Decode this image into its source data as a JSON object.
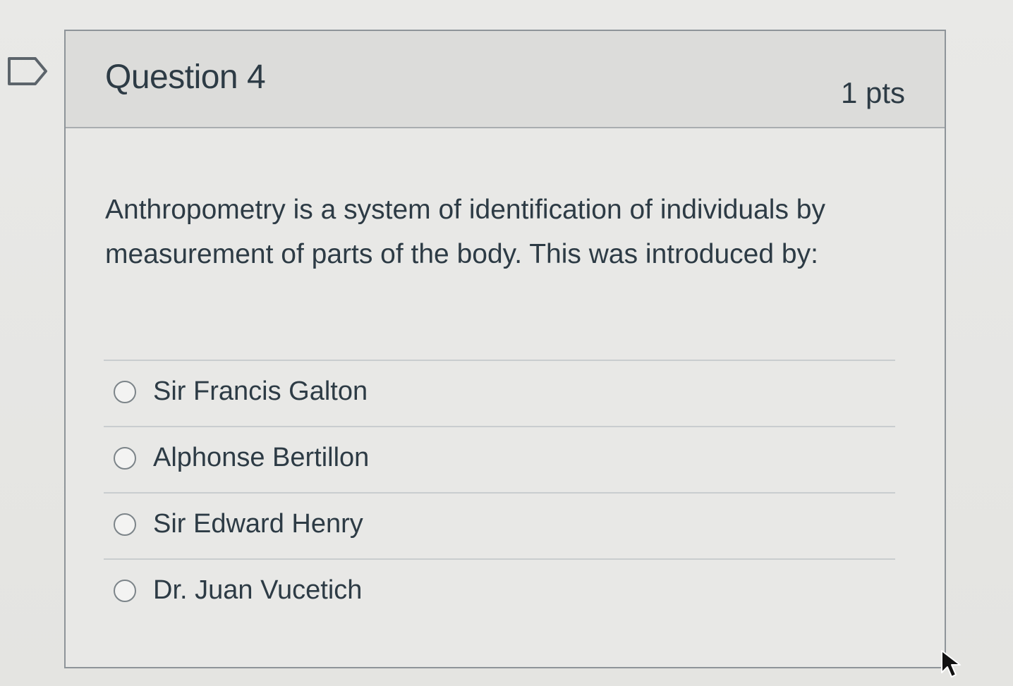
{
  "question": {
    "title": "Question 4",
    "points": "1 pts",
    "text": "Anthropometry is a system of identification of individuals by measurement of parts of the body. This was introduced by:",
    "flag_icon": "flag-outline-icon"
  },
  "answers": [
    {
      "label": "Sir Francis Galton",
      "selected": false
    },
    {
      "label": "Alphonse Bertillon",
      "selected": false
    },
    {
      "label": "Sir Edward Henry",
      "selected": false
    },
    {
      "label": "Dr. Juan Vucetich",
      "selected": false
    }
  ],
  "colors": {
    "text": "#2d3b45",
    "header_background": "#dcdcda",
    "border": "#8e9499"
  }
}
